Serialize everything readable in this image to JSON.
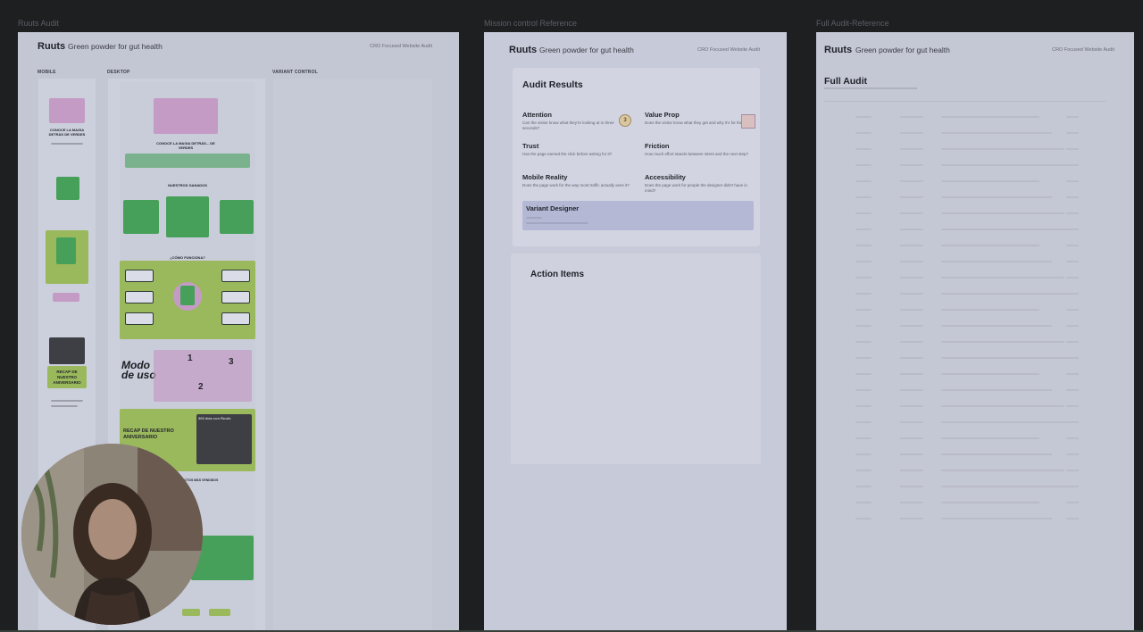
{
  "frames": [
    {
      "label": "Ruuts Audit",
      "brand": "Ruuts",
      "tagline": "Green powder for gut health",
      "subtitle": "CRO Focused Website Audit"
    },
    {
      "label": "Mission control Reference",
      "brand": "Ruuts",
      "tagline": "Green powder for gut health",
      "subtitle": "CRO Focused Website Audit"
    },
    {
      "label": "Full Audit-Reference",
      "brand": "Ruuts",
      "tagline": "Green powder for gut health",
      "subtitle": "CRO Focused Website Audit"
    }
  ],
  "audit_frame": {
    "columns": {
      "mobile": "MOBILE",
      "desktop": "DESKTOP",
      "variant": "VARIANT CONTROL"
    },
    "desktop_page": {
      "section_1": "CONOCE LA MAGIA DETRÁS... DE VERDES",
      "section_2": "NUESTROS GANADOS",
      "section_3": "¿CÓMO FUNCIONA?",
      "modo_title": "Modo de uso",
      "steps": [
        "1",
        "2",
        "3"
      ],
      "recap_title": "RECAP DE NUESTRO ANIVERSARIO",
      "anniversary_badge": "365 días con Ruuts",
      "footer_heading": "PRODUCTOS MÁS VENDIDOS"
    },
    "mobile_page": {
      "heading_1": "CONOCE LA MAGIA DETRÁS DE VERDES",
      "recap_title": "RECAP DE NUESTRO ANIVERSARIO"
    }
  },
  "mission_control": {
    "audit_results_title": "Audit Results",
    "metrics": [
      {
        "title": "Attention",
        "desc": "Can the visitor know what they're looking at in three seconds?",
        "score": "3"
      },
      {
        "title": "Value Prop",
        "desc": "Does the visitor know what they get and why it's for them?"
      },
      {
        "title": "Trust",
        "desc": "Has the page earned the click before asking for it?"
      },
      {
        "title": "Friction",
        "desc": "How much effort stands between intent and the next step?"
      },
      {
        "title": "Mobile Reality",
        "desc": "Does the page work for the way most traffic actually sees it?"
      },
      {
        "title": "Accessibility",
        "desc": "Does the page work for people the designer didn't have in mind?"
      }
    ],
    "variant_designer": {
      "title": "Variant Designer"
    },
    "action_items_title": "Action Items"
  },
  "full_audit": {
    "title": "Full Audit"
  },
  "colors": {
    "frame_bg": "#c3c6d3",
    "canvas_bg": "#1e1f21",
    "variant_highlight": "#b5b8d4"
  }
}
